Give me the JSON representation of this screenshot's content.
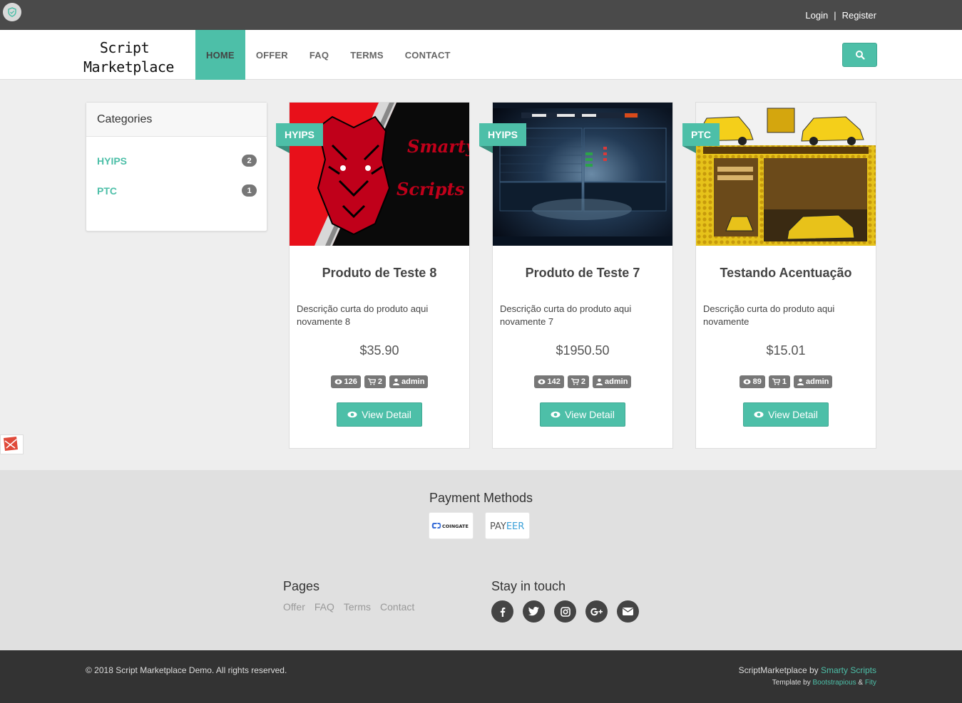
{
  "topbar": {
    "login": "Login",
    "separator": "|",
    "register": "Register"
  },
  "brand": {
    "line1": "Script",
    "line2": "Marketplace"
  },
  "nav": [
    "HOME",
    "OFFER",
    "FAQ",
    "TERMS",
    "CONTACT"
  ],
  "sidebar": {
    "title": "Categories",
    "categories": [
      {
        "label": "HYIPS",
        "count": "2"
      },
      {
        "label": "PTC",
        "count": "1"
      }
    ]
  },
  "products": [
    {
      "category": "HYIPS",
      "title": "Produto de Teste 8",
      "description": "Descrição curta do produto aqui novamente 8",
      "price": "$35.90",
      "views": "126",
      "cart": "2",
      "author": "admin",
      "button": "View Detail",
      "image_text_1": "Smarty",
      "image_text_2": "Scripts"
    },
    {
      "category": "HYIPS",
      "title": "Produto de Teste 7",
      "description": "Descrição curta do produto aqui novamente 7",
      "price": "$1950.50",
      "views": "142",
      "cart": "2",
      "author": "admin",
      "button": "View Detail"
    },
    {
      "category": "PTC",
      "title": "Testando Acentuação",
      "description": "Descrição curta do produto aqui novamente",
      "price": "$15.01",
      "views": "89",
      "cart": "1",
      "author": "admin",
      "button": "View Detail"
    }
  ],
  "footer": {
    "payment_title": "Payment Methods",
    "payment_methods": [
      "COINGATE",
      "PAYEER"
    ],
    "pages_title": "Pages",
    "pages": [
      "Offer",
      "FAQ",
      "Terms",
      "Contact"
    ],
    "stay_title": "Stay in touch",
    "socials": [
      "facebook-icon",
      "twitter-icon",
      "instagram-icon",
      "google-plus-icon",
      "envelope-icon"
    ]
  },
  "bottom": {
    "copyright": "© 2018 Script Marketplace Demo. All rights reserved.",
    "credit_prefix": "ScriptMarketplace by ",
    "credit_link": "Smarty Scripts",
    "template_prefix": "Template by ",
    "template_link1": "Bootstrapious",
    "template_amp": " & ",
    "template_link2": "Fity"
  },
  "colors": {
    "accent": "#4dbfa8",
    "topbar": "#4a4a4a",
    "bottombar": "#333333",
    "badge": "#777777"
  }
}
